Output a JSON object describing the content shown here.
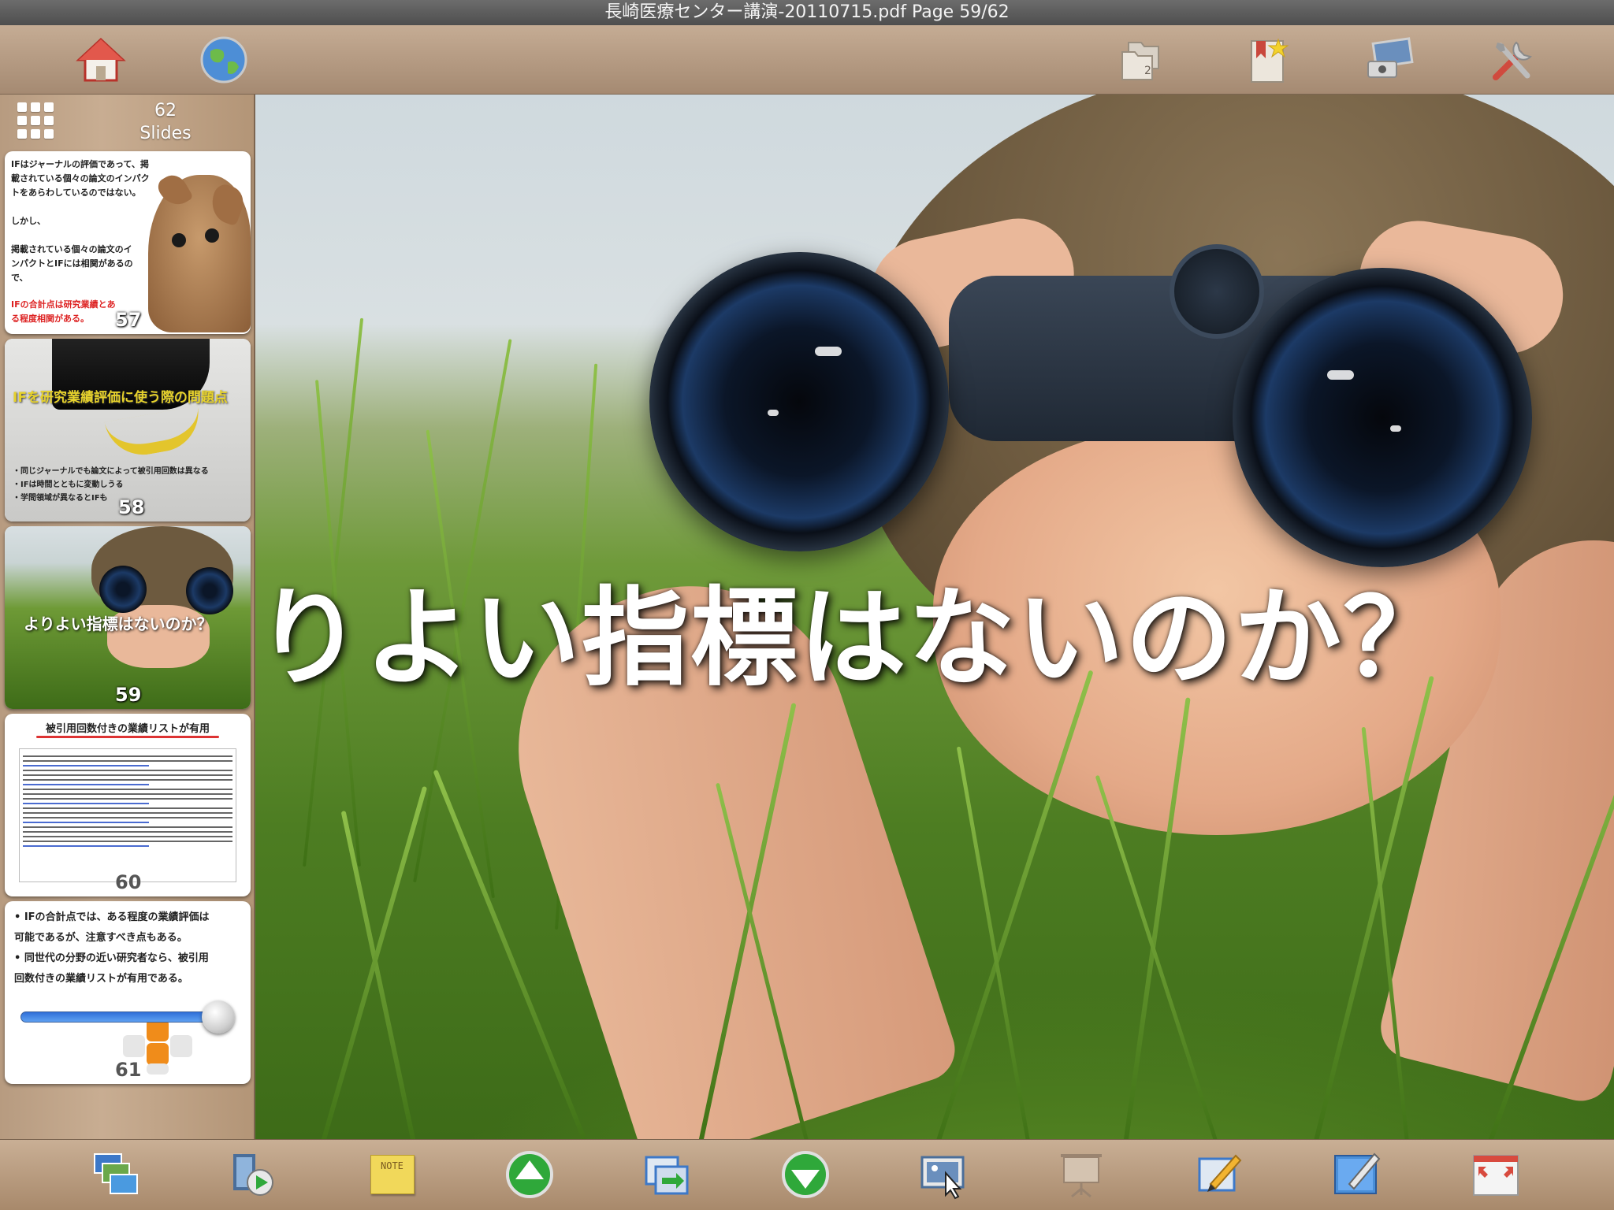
{
  "titlebar": {
    "title": "長崎医療センター講演-20110715.pdf  Page 59/62"
  },
  "toolbar_top": {
    "left_icons": [
      "home-icon",
      "globe-icon"
    ],
    "right_icons": [
      "folders-icon",
      "bookmark-star-icon",
      "display-icon",
      "tools-icon"
    ]
  },
  "sidebar": {
    "slide_count_number": "62",
    "slide_count_label": "Slides",
    "slider_position": 0.93,
    "thumbnails": [
      {
        "number": "57",
        "lines": "IFはジャーナルの評価であって、掲\n載されている個々の論文のインパク\nトをあらわしているのではない。\n\nしかし、\n\n掲載されている個々の論文のイ\nンパクトとIFには相関があるの\nで、",
        "red_text": "IFの合計点は研究業績とあ\nる程度相関がある。"
      },
      {
        "number": "58",
        "title": "IFを研究業績評価に使う際の問題点",
        "lines": "・同じジャーナルでも論文によって被引用回数は異なる\n・IFは時間とともに変動しうる\n・学問領域が異なるとIFも"
      },
      {
        "number": "59",
        "caption": "よりよい指標はないのか？"
      },
      {
        "number": "60",
        "title": "被引用回数付きの業績リストが有用"
      },
      {
        "number": "61",
        "bullets": [
          "• IFの合計点では、ある程度の業績評価は",
          "  可能であるが、注意すべき点もある。",
          "• 同世代の分野の近い研究者なら、被引用",
          "  回数付きの業績リストが有用である。"
        ]
      }
    ]
  },
  "main": {
    "slide_text": "りよい指標はないのか？"
  },
  "toolbar_bottom": {
    "icons": [
      "windows-icon",
      "slideshow-play-icon",
      "note-icon",
      "up-arrow-icon",
      "export-icon",
      "down-arrow-icon",
      "image-cursor-icon",
      "presentation-screen-icon",
      "pen-annotate-icon",
      "draw-board-icon",
      "fullscreen-icon"
    ],
    "note_label": "NOTE"
  },
  "colors": {
    "slider_blue": "#2f6fd8",
    "arrow_green": "#2fa83a",
    "note_yellow": "#f1d85a",
    "thumb_red": "#dd2222"
  }
}
